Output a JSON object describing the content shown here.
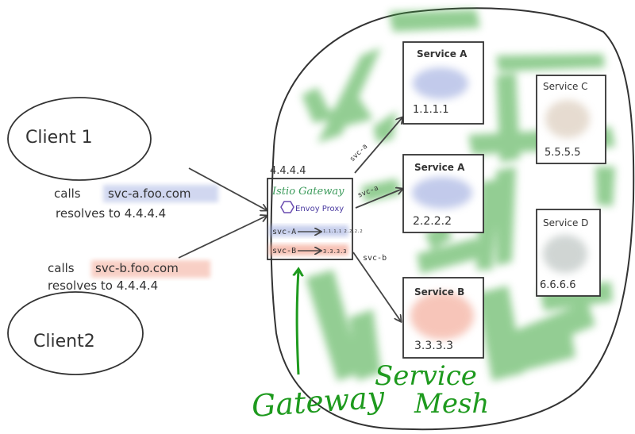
{
  "clients": [
    {
      "label": "Client 1"
    },
    {
      "label": "Client2"
    }
  ],
  "calls": [
    {
      "calls_prefix": "calls",
      "host": "svc-a.foo.com",
      "resolves": "resolves to 4.4.4.4"
    },
    {
      "calls_prefix": "calls",
      "host": "svc-b.foo.com",
      "resolves": "resolves to 4.4.4.4"
    }
  ],
  "gateway": {
    "ip": "4.4.4.4",
    "title": "Istio Gateway",
    "proxy": "Envoy Proxy",
    "routes": [
      {
        "name": "svc-A",
        "targets": "1.1.1.1 2.2.2.2"
      },
      {
        "name": "svc-B",
        "targets": "3.3.3.3"
      }
    ],
    "caption": "Gateway"
  },
  "arrows": {
    "top": "svc-a",
    "middle": "svc-a",
    "bottom": "svc-b"
  },
  "services": [
    {
      "name": "Service A",
      "ip": "1.1.1.1"
    },
    {
      "name": "Service A",
      "ip": "2.2.2.2"
    },
    {
      "name": "Service B",
      "ip": "3.3.3.3"
    },
    {
      "name": "Service C",
      "ip": "5.5.5.5"
    },
    {
      "name": "Service D",
      "ip": "6.6.6.6"
    }
  ],
  "mesh_label": [
    "Service",
    "Mesh"
  ],
  "colors": {
    "green": "#1e9a1e",
    "svc_a_blue": "#9aa8de",
    "svc_b_red": "#f2a08c",
    "svc_c_beige": "#d9c9b8",
    "svc_d_grey": "#b7c0bd",
    "stroke": "#333333"
  }
}
